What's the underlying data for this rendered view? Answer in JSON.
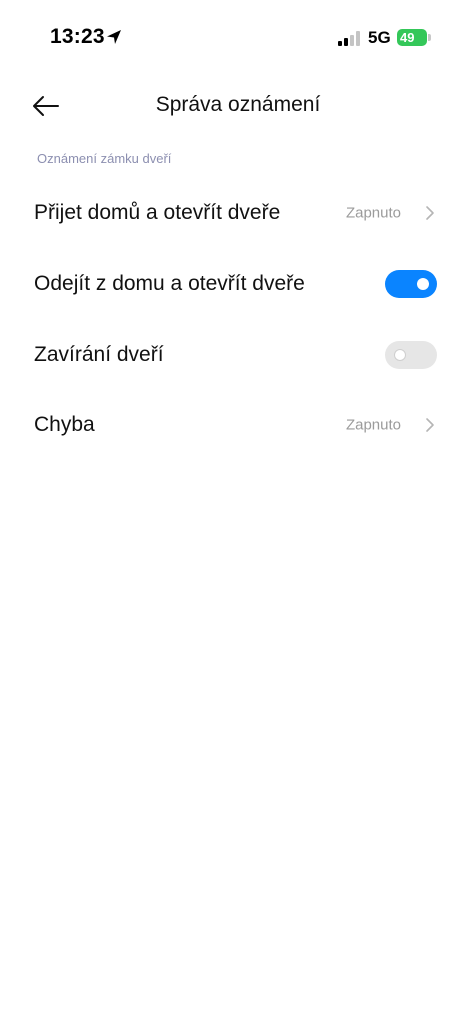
{
  "status_bar": {
    "time": "13:23",
    "network": "5G",
    "battery": "49"
  },
  "header": {
    "title": "Správa oznámení"
  },
  "section": {
    "label": "Oznámení zámku dveří"
  },
  "rows": [
    {
      "label": "Přijet domů a otevřít dveře",
      "value": "Zapnuto",
      "type": "link"
    },
    {
      "label": "Odejít z domu a otevřít dveře",
      "type": "toggle",
      "checked": true
    },
    {
      "label": "Zavírání dveří",
      "type": "toggle",
      "checked": false
    },
    {
      "label": "Chyba",
      "value": "Zapnuto",
      "type": "link"
    }
  ],
  "colors": {
    "toggle_on": "#0a84ff",
    "toggle_off": "#e6e6e6",
    "section_label": "#8c8fb0",
    "battery": "#34c759"
  },
  "icons": [
    "location-arrow-icon",
    "signal-icon",
    "battery-icon",
    "back-arrow-icon",
    "chevron-right-icon"
  ]
}
